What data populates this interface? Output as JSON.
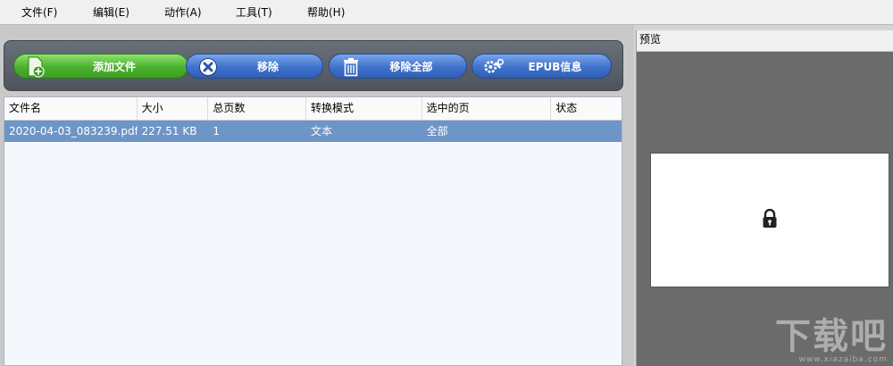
{
  "menu": {
    "items": [
      "文件(F)",
      "编辑(E)",
      "动作(A)",
      "工具(T)",
      "帮助(H)"
    ]
  },
  "toolbar": {
    "add_label": "添加文件",
    "remove_label": "移除",
    "remove_all_label": "移除全部",
    "epub_label": "EPUB信息"
  },
  "table": {
    "columns": [
      "文件名",
      "大小",
      "总页数",
      "转换模式",
      "选中的页",
      "状态"
    ],
    "rows": [
      [
        "2020-04-03_083239.pdf",
        "227.51 KB",
        "1",
        "文本",
        "全部",
        ""
      ]
    ]
  },
  "preview": {
    "title": "预览"
  },
  "watermark": {
    "main": "下载吧",
    "url": "www.xiazaiba.com"
  },
  "colors": {
    "accent_green": "#4bb12e",
    "accent_blue": "#3f72cc",
    "selected_row": "#6e95c7",
    "toolbar_bg": "#5a6068",
    "preview_bg": "#6b6b6b"
  },
  "icons": [
    "add-file-icon",
    "remove-x-icon",
    "trash-icon",
    "gear-icon",
    "lock-icon"
  ]
}
